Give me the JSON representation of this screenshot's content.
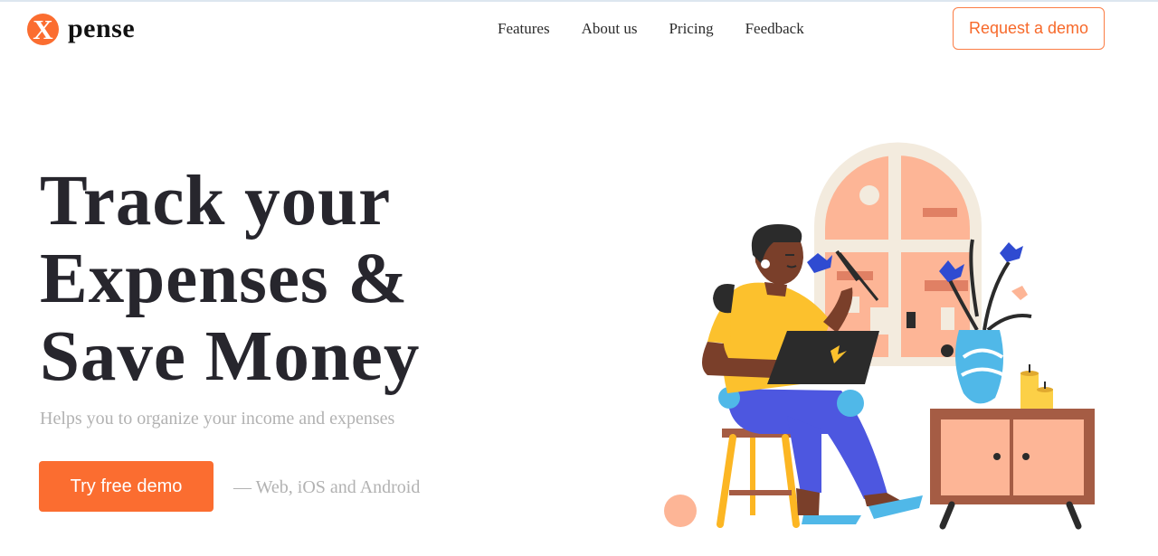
{
  "header": {
    "logo": {
      "badge": "X",
      "word": "pense"
    },
    "nav": [
      "Features",
      "About us",
      "Pricing",
      "Feedback"
    ],
    "cta_label": "Request a demo"
  },
  "hero": {
    "headline": [
      "Track your",
      "Expenses &",
      "Save Money"
    ],
    "subtitle": "Helps you to organize your income and expenses",
    "cta_label": "Try free demo",
    "platforms": "— Web, iOS and Android"
  },
  "colors": {
    "accent": "#fb6d30",
    "heading": "#27262d",
    "muted": "#b2b2b2"
  },
  "illustration": {
    "icon": "woman-with-laptop-illustration"
  }
}
